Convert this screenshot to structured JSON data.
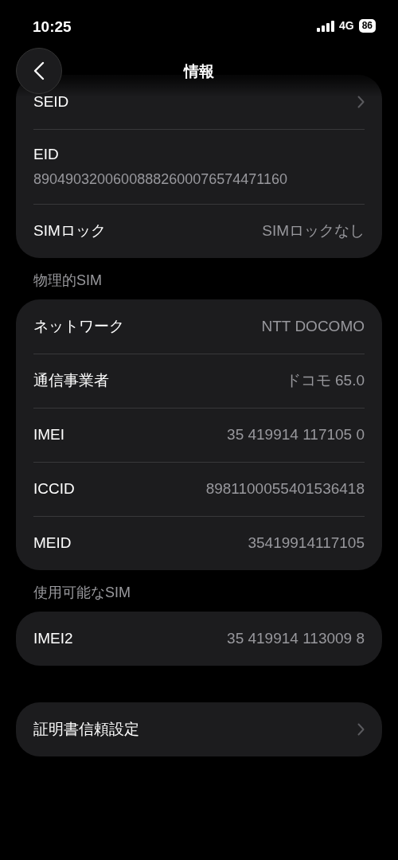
{
  "status_bar": {
    "time": "10:25",
    "network": "4G",
    "battery": "86"
  },
  "header": {
    "title": "情報"
  },
  "groups": [
    {
      "rows": [
        {
          "kind": "link",
          "label": "SEID"
        },
        {
          "kind": "stacked",
          "label": "EID",
          "value": "89049032006008882600076574471160"
        },
        {
          "kind": "value",
          "label": "SIMロック",
          "value": "SIMロックなし"
        }
      ]
    },
    {
      "heading": "物理的SIM",
      "rows": [
        {
          "kind": "value",
          "label": "ネットワーク",
          "value": "NTT DOCOMO"
        },
        {
          "kind": "value",
          "label": "通信事業者",
          "value": "ドコモ 65.0"
        },
        {
          "kind": "value",
          "label": "IMEI",
          "value": "35 419914 117105 0"
        },
        {
          "kind": "value",
          "label": "ICCID",
          "value": "8981100055401536418"
        },
        {
          "kind": "value",
          "label": "MEID",
          "value": "35419914117105"
        }
      ]
    },
    {
      "heading": "使用可能なSIM",
      "rows": [
        {
          "kind": "value",
          "label": "IMEI2",
          "value": "35 419914 113009 8"
        }
      ]
    },
    {
      "rows": [
        {
          "kind": "link",
          "label": "証明書信頼設定"
        }
      ]
    }
  ]
}
